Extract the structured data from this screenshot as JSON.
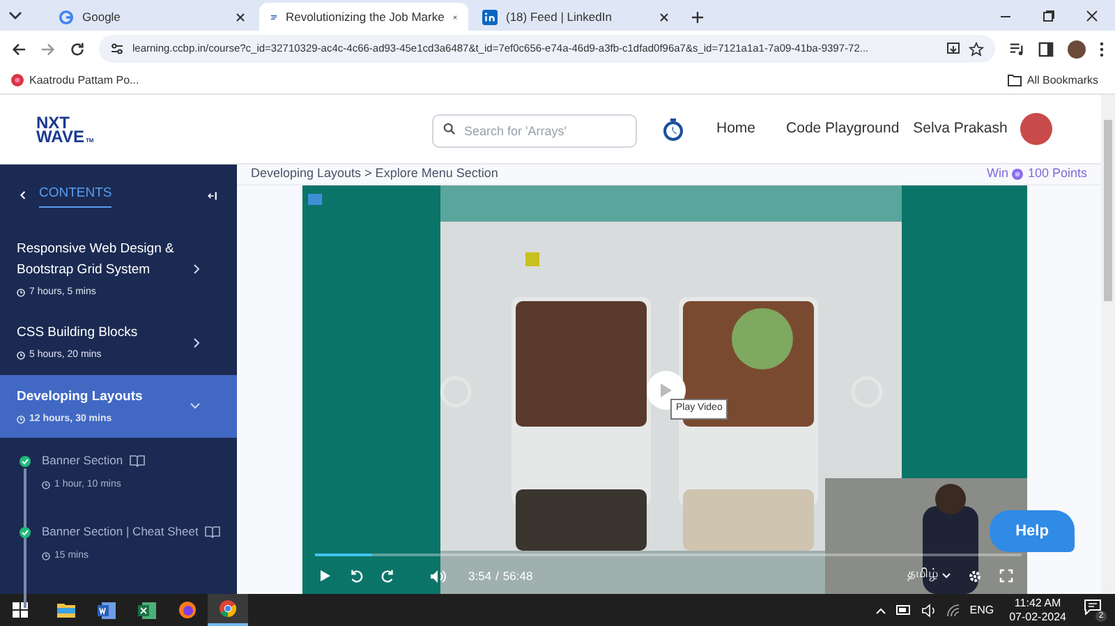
{
  "browser": {
    "tabs": [
      {
        "title": "Google",
        "selected": false,
        "kind": "google"
      },
      {
        "title": "Revolutionizing the Job Marke",
        "selected": true,
        "kind": "course"
      },
      {
        "title": "(18) Feed | LinkedIn",
        "selected": false,
        "kind": "linkedin"
      }
    ],
    "url": "learning.ccbp.in/course?c_id=32710329-ac4c-4c66-ad93-45e1cd3a6487&t_id=7ef0c656-e74a-46d9-a3fb-c1dfad0f96a7&s_id=7121a1a1-7a09-41ba-9397-72...",
    "bookmarks": [
      {
        "label": "Kaatrodu Pattam Po..."
      }
    ],
    "all_bookmarks": "All Bookmarks"
  },
  "header": {
    "logo": [
      "NXT",
      "WAVE"
    ],
    "logo_mark": "TM",
    "search": {
      "placeholder": "Search for 'Arrays'"
    },
    "nav": [
      "Home",
      "Code Playground"
    ],
    "user": "Selva Prakash"
  },
  "breadcrumb": "Developing Layouts > Explore Menu Section",
  "reward": {
    "prefix": "Win",
    "points": "100 Points"
  },
  "sidebar": {
    "title": "CONTENTS",
    "modules": [
      {
        "title": "Responsive Web Design & Bootstrap Grid System",
        "duration": "7 hours, 5 mins",
        "selected": false,
        "expanded": false
      },
      {
        "title": "CSS Building Blocks",
        "duration": "5 hours, 20 mins",
        "selected": false,
        "expanded": false
      },
      {
        "title": "Developing Layouts",
        "duration": "12 hours, 30 mins",
        "selected": true,
        "expanded": true
      }
    ],
    "sessions": [
      {
        "title": "Banner Section",
        "duration": "1 hour, 10 mins",
        "completed": true
      },
      {
        "title": "Banner Section | Cheat Sheet",
        "duration": "15 mins",
        "completed": true
      }
    ]
  },
  "player": {
    "tooltip": "Play Video",
    "current": "3:54",
    "separator": "/",
    "total": "56:48",
    "language": "தமிழ்",
    "progress": {
      "level": 0.08
    }
  },
  "help": "Help",
  "taskbar": {
    "apps": [
      {
        "kind": "windows",
        "selected": false
      },
      {
        "kind": "folder",
        "selected": false
      },
      {
        "kind": "word",
        "selected": false
      },
      {
        "kind": "excel",
        "selected": false
      },
      {
        "kind": "firefox",
        "selected": false
      },
      {
        "kind": "chrome",
        "selected": true
      }
    ],
    "language": "ENG",
    "time": "11:42 AM",
    "date": "07-02-2024",
    "notifications": "2"
  }
}
